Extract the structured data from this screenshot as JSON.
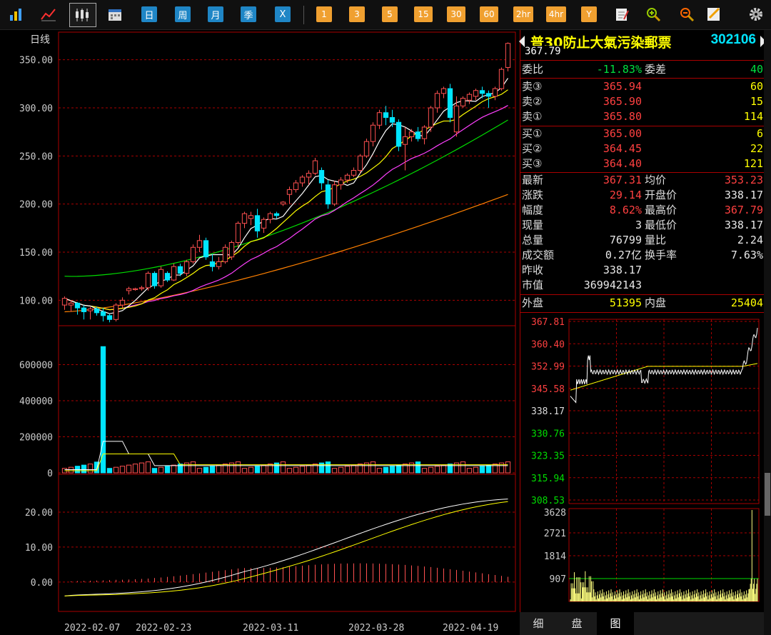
{
  "toolbar": {
    "period_buttons": [
      "日",
      "周",
      "月",
      "季",
      "X"
    ],
    "interval_buttons": [
      "1",
      "3",
      "5",
      "15",
      "30",
      "60",
      "2hr",
      "4hr",
      "Y"
    ],
    "icons": [
      "bar-chart-icon",
      "line-chart-icon",
      "candlestick-icon",
      "calendar-icon",
      "notepad-icon",
      "zoom-in-icon",
      "zoom-out-icon",
      "edit-icon",
      "gear-icon"
    ]
  },
  "chart": {
    "period_label": "日线",
    "price_axis_labels": [
      "350.00",
      "300.00",
      "250.00",
      "200.00",
      "150.00",
      "100.00"
    ],
    "volume_axis_labels": [
      "600000",
      "400000",
      "200000",
      "0"
    ],
    "macd_axis_labels": [
      "20.00",
      "10.00",
      "0.00"
    ],
    "date_labels": [
      "2022-02-07",
      "2022-02-23",
      "2022-03-11",
      "2022-03-28",
      "2022-04-19"
    ],
    "colors": {
      "up": "#ff5050",
      "down": "#00e5ff",
      "ma5": "#ffffff",
      "ma10": "#ffff00",
      "ma20": "#ff40ff",
      "ma60": "#00dd00",
      "ma120": "#ff8000"
    }
  },
  "chart_data": {
    "type": "candlestick",
    "x_range": [
      "2022-02-07",
      "2022-04-21"
    ],
    "ylim": [
      75,
      375
    ],
    "candles": [
      [
        95,
        102,
        90,
        104
      ],
      [
        95,
        97,
        88,
        100
      ],
      [
        97,
        92,
        85,
        98
      ],
      [
        92,
        88,
        80,
        95
      ],
      [
        89,
        91,
        80,
        93
      ],
      [
        91,
        87,
        84,
        93
      ],
      [
        88,
        84,
        78,
        92
      ],
      [
        84,
        80,
        77,
        86
      ],
      [
        80,
        95,
        78,
        97
      ],
      [
        95,
        100,
        92,
        103
      ],
      [
        110,
        112,
        106,
        114
      ],
      [
        111,
        112,
        110,
        113
      ],
      [
        112,
        113,
        110,
        115
      ],
      [
        113,
        128,
        110,
        130
      ],
      [
        128,
        115,
        112,
        130
      ],
      [
        115,
        132,
        113,
        135
      ],
      [
        128,
        121,
        119,
        130
      ],
      [
        121,
        135,
        120,
        138
      ],
      [
        135,
        128,
        125,
        138
      ],
      [
        128,
        140,
        125,
        142
      ],
      [
        140,
        155,
        138,
        158
      ],
      [
        155,
        162,
        150,
        168
      ],
      [
        162,
        145,
        142,
        165
      ],
      [
        140,
        135,
        130,
        148
      ],
      [
        135,
        140,
        132,
        145
      ],
      [
        140,
        155,
        138,
        158
      ],
      [
        145,
        160,
        142,
        162
      ],
      [
        160,
        180,
        155,
        182
      ],
      [
        180,
        190,
        175,
        192
      ],
      [
        185,
        188,
        178,
        192
      ],
      [
        188,
        172,
        165,
        195
      ],
      [
        175,
        184,
        170,
        186
      ],
      [
        184,
        190,
        180,
        192
      ],
      [
        190,
        188,
        185,
        192
      ],
      [
        200,
        202,
        198,
        203
      ],
      [
        210,
        215,
        200,
        218
      ],
      [
        215,
        222,
        212,
        225
      ],
      [
        222,
        228,
        218,
        230
      ],
      [
        228,
        232,
        220,
        235
      ],
      [
        232,
        245,
        230,
        248
      ],
      [
        235,
        222,
        215,
        238
      ],
      [
        220,
        200,
        195,
        225
      ],
      [
        200,
        220,
        198,
        224
      ],
      [
        220,
        225,
        215,
        228
      ],
      [
        225,
        230,
        222,
        232
      ],
      [
        230,
        235,
        228,
        238
      ],
      [
        235,
        250,
        232,
        252
      ],
      [
        250,
        265,
        248,
        268
      ],
      [
        265,
        282,
        260,
        285
      ],
      [
        282,
        295,
        278,
        298
      ],
      [
        295,
        290,
        282,
        302
      ],
      [
        290,
        285,
        280,
        298
      ],
      [
        285,
        260,
        255,
        288
      ],
      [
        262,
        270,
        235,
        280
      ],
      [
        270,
        275,
        265,
        278
      ],
      [
        275,
        268,
        265,
        280
      ],
      [
        268,
        280,
        262,
        282
      ],
      [
        280,
        300,
        275,
        302
      ],
      [
        300,
        315,
        295,
        318
      ],
      [
        315,
        320,
        310,
        322
      ],
      [
        320,
        290,
        285,
        325
      ],
      [
        275,
        302,
        270,
        312
      ],
      [
        302,
        310,
        300,
        312
      ],
      [
        308,
        314,
        304,
        316
      ],
      [
        312,
        318,
        308,
        320
      ],
      [
        318,
        315,
        310,
        322
      ],
      [
        315,
        312,
        300,
        318
      ],
      [
        312,
        320,
        308,
        322
      ],
      [
        320,
        340,
        318,
        342
      ],
      [
        342,
        367,
        338,
        368
      ]
    ],
    "moving_averages": [
      "MA5",
      "MA10",
      "MA20",
      "MA60",
      "MA120"
    ],
    "volume_spike": 700000,
    "macd_range": [
      -8,
      30
    ]
  },
  "panel": {
    "name": "普30防止大氣污染郵票",
    "code": "302106",
    "last_price_label": "367.79",
    "weibi": {
      "label": "委比",
      "value": "-11.83%",
      "label2": "委差",
      "value2": "40"
    },
    "asks": [
      {
        "label": "卖③",
        "price": "365.94",
        "qty": "60"
      },
      {
        "label": "卖②",
        "price": "365.90",
        "qty": "15"
      },
      {
        "label": "卖①",
        "price": "365.80",
        "qty": "114"
      }
    ],
    "bids": [
      {
        "label": "买①",
        "price": "365.00",
        "qty": "6"
      },
      {
        "label": "买②",
        "price": "364.45",
        "qty": "22"
      },
      {
        "label": "买③",
        "price": "364.40",
        "qty": "121"
      }
    ],
    "quote": [
      {
        "label": "最新",
        "value": "367.31",
        "label2": "均价",
        "value2": "353.23"
      },
      {
        "label": "涨跌",
        "value": "29.14",
        "label2": "开盘价",
        "value2": "338.17"
      },
      {
        "label": "幅度",
        "value": "8.62%",
        "label2": "最高价",
        "value2": "367.79"
      },
      {
        "label": "现量",
        "value": "3",
        "label2": "最低价",
        "value2": "338.17"
      },
      {
        "label": "总量",
        "value": "76799",
        "label2": "量比",
        "value2": "2.24"
      },
      {
        "label": "成交额",
        "value": "0.27亿",
        "label2": "换手率",
        "value2": "7.63%"
      },
      {
        "label": "昨收",
        "value": "338.17",
        "label2": "",
        "value2": ""
      },
      {
        "label": "市值",
        "value": "369942143",
        "label2": "",
        "value2": ""
      }
    ],
    "outer_inner": {
      "label": "外盘",
      "value": "51395",
      "label2": "内盘",
      "value2": "25404"
    },
    "intraday_price_labels": [
      "367.81",
      "360.40",
      "352.99",
      "345.58",
      "338.17",
      "330.76",
      "323.35",
      "315.94",
      "308.53"
    ],
    "intraday_volume_labels": [
      "3628",
      "2721",
      "1814",
      "907"
    ]
  },
  "tabs": [
    "细",
    "盘",
    "图"
  ]
}
